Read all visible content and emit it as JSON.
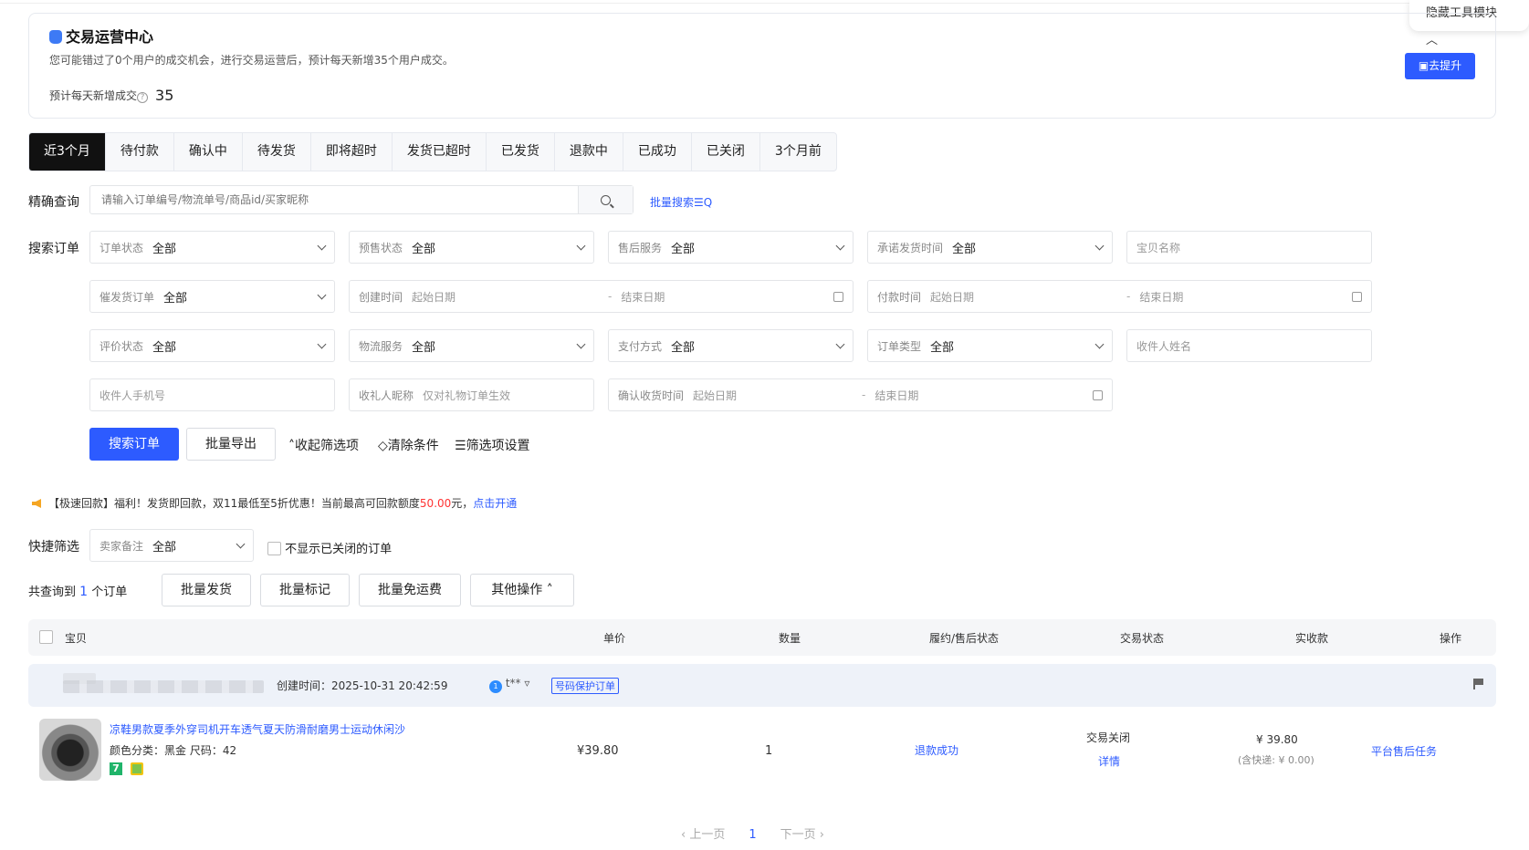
{
  "hide_tool": "隐藏工具模块",
  "card": {
    "title": "交易运营中心",
    "desc": "您可能错过了0个用户的成交机会，进行交易运营后，预计每天新增35个用户成交。",
    "est_label": "预计每天新增成交",
    "est_value": "35",
    "promote": "去提升"
  },
  "tabs": [
    "近3个月",
    "待付款",
    "确认中",
    "待发货",
    "即将超时",
    "发货已超时",
    "已发货",
    "退款中",
    "已成功",
    "已关闭",
    "3个月前"
  ],
  "precise": {
    "label": "精确查询",
    "placeholder": "请输入订单编号/物流单号/商品id/买家昵称",
    "batch": "批量搜索☰Q"
  },
  "search_label": "搜索订单",
  "filters": {
    "order_status": {
      "label": "订单状态",
      "value": "全部"
    },
    "presale": {
      "label": "预售状态",
      "value": "全部"
    },
    "aftersale": {
      "label": "售后服务",
      "value": "全部"
    },
    "promise_time": {
      "label": "承诺发货时间",
      "value": "全部"
    },
    "item_name": {
      "placeholder": "宝贝名称"
    },
    "urge": {
      "label": "催发货订单",
      "value": "全部"
    },
    "create_time": {
      "label": "创建时间",
      "start": "起始日期",
      "end": "结束日期"
    },
    "pay_time": {
      "label": "付款时间",
      "start": "起始日期",
      "end": "结束日期"
    },
    "review": {
      "label": "评价状态",
      "value": "全部"
    },
    "logistics": {
      "label": "物流服务",
      "value": "全部"
    },
    "pay_method": {
      "label": "支付方式",
      "value": "全部"
    },
    "order_type": {
      "label": "订单类型",
      "value": "全部"
    },
    "receiver_name": {
      "placeholder": "收件人姓名"
    },
    "receiver_phone": {
      "placeholder": "收件人手机号"
    },
    "gift_nick": {
      "label": "收礼人昵称",
      "placeholder": "仅对礼物订单生效"
    },
    "confirm_time": {
      "label": "确认收货时间",
      "start": "起始日期",
      "end": "结束日期"
    }
  },
  "actions": {
    "search": "搜索订单",
    "export": "批量导出",
    "collapse": "收起筛选项",
    "clear": "清除条件",
    "settings": "筛选项设置"
  },
  "notice": {
    "text1": "【极速回款】福利！发货即回款，双11最低至5折优惠！当前最高可回款额度",
    "amount": "50.00",
    "text2": "元，",
    "link": "点击开通"
  },
  "quick": {
    "label": "快捷筛选",
    "remark_label": "卖家备注",
    "remark_value": "全部",
    "hide_closed": "不显示已关闭的订单"
  },
  "summary": {
    "prefix": "共查询到",
    "count": "1",
    "suffix": "个订单",
    "buttons": [
      "批量发货",
      "批量标记",
      "批量免运费",
      "其他操作"
    ]
  },
  "table": {
    "headers": [
      "宝贝",
      "单价",
      "数量",
      "履约/售后状态",
      "交易状态",
      "实收款",
      "操作"
    ]
  },
  "order": {
    "created": "创建时间：2025-10-31 20:42:59",
    "buyer": "t**",
    "protect": "号码保护订单",
    "title": "凉鞋男款夏季外穿司机开车透气夏天防滑耐磨男士运动休闲沙",
    "attrs": "颜色分类：黑金   尺码：42",
    "badge": "7",
    "price": "¥39.80",
    "qty": "1",
    "aftersale": "退款成功",
    "trade_status": "交易关闭",
    "detail": "详情",
    "paid": "¥ 39.80",
    "shipping": "(含快递: ¥ 0.00)",
    "op": "平台售后任务"
  },
  "pager": {
    "prev": "上一页",
    "current": "1",
    "next": "下一页"
  }
}
